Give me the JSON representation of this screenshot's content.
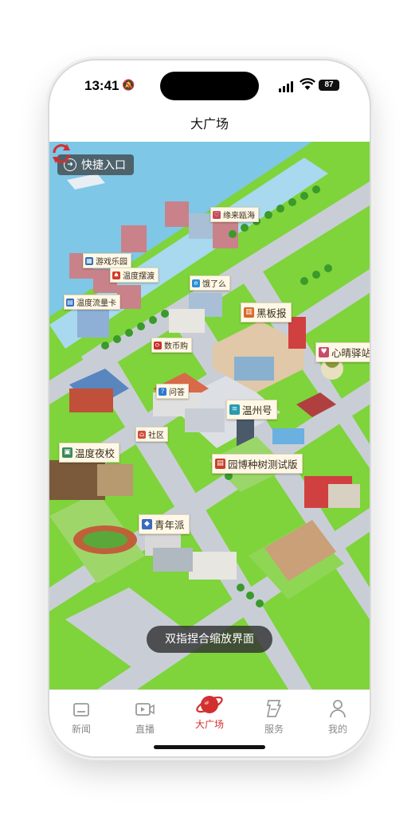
{
  "status": {
    "time": "13:41",
    "battery": "87"
  },
  "header": {
    "title": "大广场"
  },
  "map": {
    "shortcut_label": "快捷入口",
    "hint_toast": "双指捏合缩放界面",
    "places": [
      {
        "name": "缘来瓯海",
        "color": "#c24a5a",
        "glyph": "♡"
      },
      {
        "name": "游戏乐园",
        "color": "#2f6fb0",
        "glyph": "▦"
      },
      {
        "name": "温度摆渡",
        "color": "#d33a2a",
        "glyph": "♠"
      },
      {
        "name": "饿了么",
        "color": "#2a8fd8",
        "glyph": "e"
      },
      {
        "name": "温度流量卡",
        "color": "#2a6fc4",
        "glyph": "▤"
      },
      {
        "name": "黑板报",
        "color": "#d86a2a",
        "glyph": "▥"
      },
      {
        "name": "数币购",
        "color": "#c8302a",
        "glyph": "⟳"
      },
      {
        "name": "心晴驿站",
        "color": "#c94a6a",
        "glyph": "♥"
      },
      {
        "name": "问答",
        "color": "#2a7ad0",
        "glyph": "?"
      },
      {
        "name": "温州号",
        "color": "#2a9ab0",
        "glyph": "≡"
      },
      {
        "name": "社区",
        "color": "#d34a3a",
        "glyph": "⌂"
      },
      {
        "name": "温度夜校",
        "color": "#3a8a5a",
        "glyph": "▣"
      },
      {
        "name": "园博种树测试版",
        "color": "#c8402a",
        "glyph": "▤"
      },
      {
        "name": "青年派",
        "color": "#3a6ac0",
        "glyph": "◆"
      }
    ]
  },
  "tabbar": {
    "items": [
      {
        "label": "新闻",
        "icon": "news-icon"
      },
      {
        "label": "直播",
        "icon": "live-video-icon"
      },
      {
        "label": "大广场",
        "icon": "planet-icon"
      },
      {
        "label": "服务",
        "icon": "service-icon"
      },
      {
        "label": "我的",
        "icon": "profile-icon"
      }
    ],
    "active": "大广场"
  },
  "colors": {
    "accent": "#d32f2f",
    "grass": "#7ed43a",
    "water": "#7ec7e6",
    "road": "#c9ced6"
  }
}
